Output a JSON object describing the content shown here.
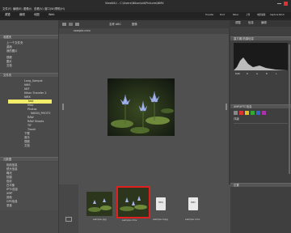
{
  "window": {
    "title": "ViewNX-i - C:\\Users\\Nikon\\sid\\Pictures\\NMX"
  },
  "menu": [
    "文件(F)",
    "编辑(E)",
    "图像(I)",
    "查看(V)",
    "窗口(W)",
    "帮助(H)"
  ],
  "tabs": [
    "浏览",
    "编辑",
    "地图",
    "Web"
  ],
  "top_right_buttons": [
    "Transfer",
    "Print",
    "Nikon",
    "上传",
    "电影编辑",
    "Capture NX-D"
  ],
  "left": {
    "favorites_title": "收藏夹",
    "favorites": [
      "上一个文件夹",
      "桌面",
      "我的图片"
    ],
    "libraries": [
      "视频",
      "图片",
      "文档"
    ],
    "folders_title": "文件夹",
    "tree": [
      "Long_Sample",
      "NMS",
      "NEF",
      "Nikon Transfer 2",
      "NMX",
      "test",
      "Misc",
      "Photos",
      "NIKON_PHOTO",
      "RAW",
      "RAW Shoots",
      "TIF",
      "Travel",
      "下载",
      "音乐",
      "视频",
      "文档"
    ],
    "selected_folder": "NMX",
    "metadata_title": "元数据",
    "metadata": [
      "相机信息",
      "镜头信息",
      "曝光",
      "拍摄",
      "色彩",
      "白平衡",
      "IPTC信息",
      "XMP",
      "其他",
      "GPS信息",
      "录音"
    ]
  },
  "center": {
    "path": "sample.nmv",
    "sort_label": "名称 ABC",
    "view_label": "图像"
  },
  "filmstrip": {
    "items": [
      {
        "name": "sample.jpg",
        "type": "image",
        "selected": false
      },
      {
        "name": "sample.nmv",
        "type": "image",
        "selected": true
      },
      {
        "name": "sample.mpg",
        "type": "file",
        "badge": "MPG",
        "selected": false
      },
      {
        "name": "sample.nmv",
        "type": "file",
        "badge": "NMV",
        "selected": false
      }
    ]
  },
  "right": {
    "header_tabs": [
      "调整",
      "信息",
      "编辑"
    ],
    "histogram_title": "直方图/拍摄信息",
    "histogram_labels": [
      "RGB",
      "R",
      "G",
      "B",
      "L"
    ],
    "xmp_title": "XMP/IPTC信息",
    "xmp_label": "评级",
    "location_title": "位置"
  },
  "colors": {
    "highlight": "#f1ec6a",
    "selection": "#e02020"
  }
}
